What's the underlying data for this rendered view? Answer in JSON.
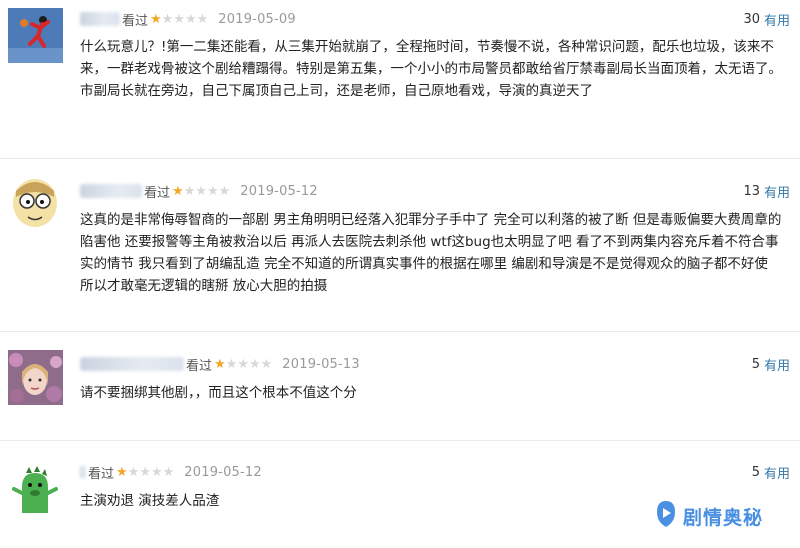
{
  "reviews": [
    {
      "watched": "看过",
      "rating": 1,
      "date": "2019-05-09",
      "votes": "30",
      "useful_label": "有用",
      "text": "什么玩意儿？!第一二集还能看，从三集开始就崩了，全程拖时间，节奏慢不说，各种常识问题，配乐也垃圾，该来不来，一群老戏骨被这个剧给糟蹋得。特别是第五集，一个小小的市局警员都敢给省厅禁毒副局长当面顶着，太无语了。市副局长就在旁边，自己下属顶自己上司，还是老师，自己原地看戏，导演的真逆天了"
    },
    {
      "watched": "看过",
      "rating": 1,
      "date": "2019-05-12",
      "votes": "13",
      "useful_label": "有用",
      "text": "这真的是非常侮辱智商的一部剧 男主角明明已经落入犯罪分子手中了 完全可以利落的被了断 但是毒贩偏要大费周章的陷害他 还要报警等主角被救治以后 再派人去医院去刺杀他 wtf这bug也太明显了吧 看了不到两集内容充斥着不符合事实的情节 我只看到了胡编乱造 完全不知道的所谓真实事件的根据在哪里 编剧和导演是不是觉得观众的脑子都不好使 所以才敢毫无逻辑的瞎掰 放心大胆的拍摄"
    },
    {
      "watched": "看过",
      "rating": 1,
      "date": "2019-05-13",
      "votes": "5",
      "useful_label": "有用",
      "text": "请不要捆绑其他剧，，而且这个根本不值这个分"
    },
    {
      "watched": "看过",
      "rating": 1,
      "date": "2019-05-12",
      "votes": "5",
      "useful_label": "有用",
      "text": "主演劝退 演技差人品渣"
    }
  ],
  "avatar_icons": [
    "basketball-player-avatar",
    "cartoon-character-avatar",
    "floral-portrait-avatar",
    "green-dinosaur-avatar"
  ],
  "watermark": {
    "text": "剧情奥秘",
    "icon": "play-logo-icon"
  },
  "colors": {
    "star_on": "#f5a623",
    "star_off": "#d8d8d8",
    "useful": "#3377aa",
    "watermark": "#4a90e2"
  },
  "max_stars": 5
}
